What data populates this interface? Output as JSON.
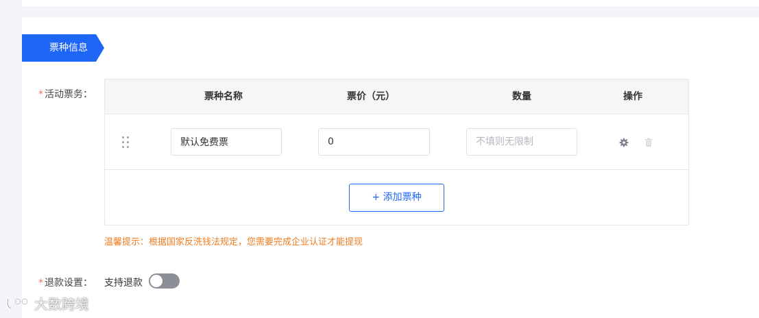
{
  "section": {
    "title": "票种信息"
  },
  "form": {
    "tickets_label": "活动票务：",
    "refund_label": "退款设置：",
    "required_mark": "*"
  },
  "table": {
    "columns": [
      "票种名称",
      "票价（元）",
      "数量",
      "操作"
    ],
    "rows": [
      {
        "name": "默认免费票",
        "price": "0",
        "quantity": "",
        "quantity_placeholder": "不填则无限制"
      }
    ],
    "add_button": "+ 添加票种",
    "actions": [
      "gear-icon",
      "trash-icon"
    ]
  },
  "tip": "温馨提示：根据国家反洗钱法规定，您需要完成企业认证才能提现",
  "refund": {
    "toggle_label": "支持退款",
    "enabled": false
  },
  "watermark": "大数跨境",
  "colors": {
    "accent": "#1e66f5",
    "tip": "#f07c1f",
    "required": "#f56c6c",
    "toggle_off": "#8c8f95"
  }
}
